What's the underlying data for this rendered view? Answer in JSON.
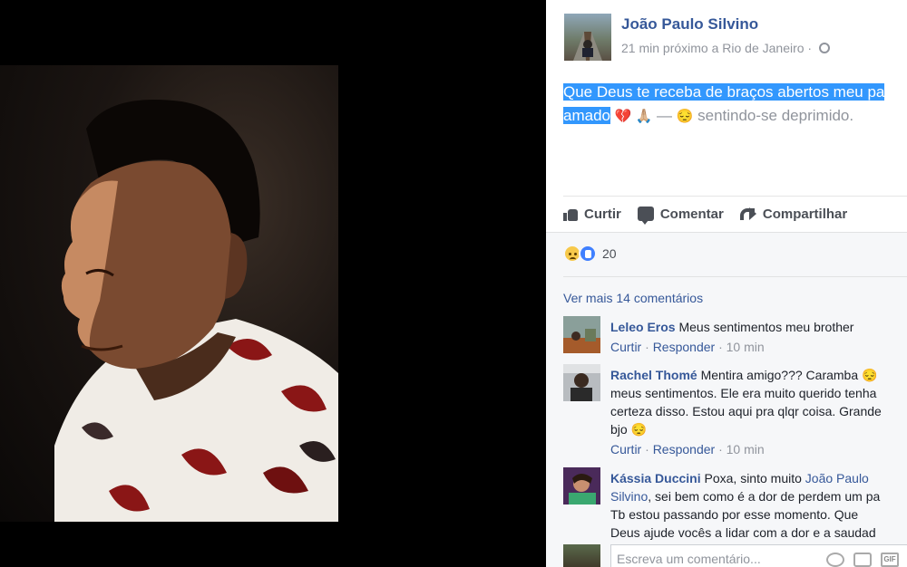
{
  "post": {
    "author": "João Paulo Silvino",
    "meta": "21 min próximo a Rio de Janeiro ·",
    "text_line1": "Que Deus te receba de braços abertos meu pa",
    "text_line2_highlight": "amado",
    "text_emoji": "💔 🙏🏼",
    "text_dash": " — ",
    "feeling_emoji": "😔",
    "feeling_text": " sentindo-se deprimido."
  },
  "actions": {
    "like": "Curtir",
    "comment": "Comentar",
    "share": "Compartilhar"
  },
  "reactions": {
    "count": "20"
  },
  "comments_header": {
    "view_more": "Ver mais 14 comentários"
  },
  "comments": [
    {
      "name": "Leleo Eros",
      "lines": [
        " Meus sentimentos meu brother"
      ],
      "like": "Curtir",
      "reply": "Responder",
      "time": " · 10 min"
    },
    {
      "name": "Rachel Thomé",
      "lines": [
        " Mentira amigo??? Caramba 😔",
        "meus sentimentos. Ele era muito querido tenha",
        "certeza disso. Estou aqui pra qlqr coisa. Grande",
        "bjo 😔"
      ],
      "like": "Curtir",
      "reply": "Responder",
      "time": " · 10 min"
    },
    {
      "name": "Kássia Duccini",
      "lines": [
        " Poxa, sinto muito ",
        "Silvino, sei bem como é a dor de perdem um pa",
        "Tb estou passando por esse momento. Que",
        "Deus ajude vocês a lidar com a dor e a saudad"
      ],
      "mention": "João Paulo",
      "mention2": "Silvino",
      "line2_rest": ", sei bem como é a dor de perdem um pa"
    }
  ],
  "separators": {
    "dot": " · "
  },
  "write_comment": {
    "placeholder": "Escreva um comentário..."
  },
  "icons": {
    "gif": "GIF"
  }
}
